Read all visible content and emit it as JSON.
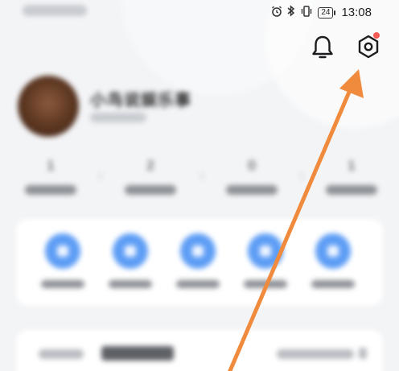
{
  "status_bar": {
    "time": "13:08",
    "battery": "24",
    "alarm_icon": "alarm-icon",
    "bluetooth_icon": "bluetooth-icon",
    "vibrate_icon": "vibrate-icon"
  },
  "header": {
    "notification_icon": "bell-icon",
    "settings_icon": "settings-gear-icon",
    "settings_has_badge": true
  },
  "profile": {
    "name": "小鸟说娱乐事"
  },
  "stats": [
    {
      "value": "1"
    },
    {
      "value": "2"
    },
    {
      "value": "0"
    },
    {
      "value": "1"
    }
  ],
  "annotation": {
    "arrow_color": "#f08a3c",
    "points_to": "settings-gear-icon"
  },
  "colors": {
    "background": "#f3f4f6",
    "service_icon_blue": "#5d9df5",
    "badge_red": "#f25c54",
    "arrow_orange": "#f08a3c"
  }
}
